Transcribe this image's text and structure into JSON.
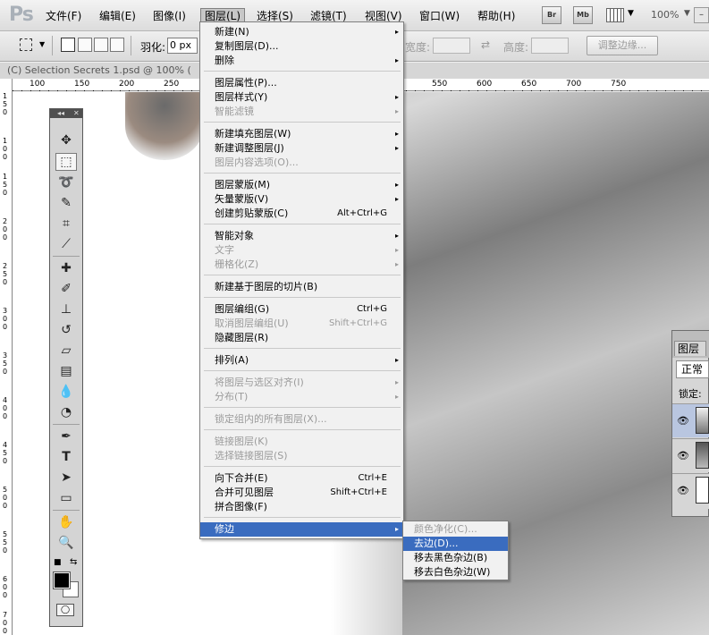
{
  "menubar": {
    "items": [
      "文件(F)",
      "编辑(E)",
      "图像(I)",
      "图层(L)",
      "选择(S)",
      "滤镜(T)",
      "视图(V)",
      "窗口(W)",
      "帮助(H)"
    ],
    "buttons": [
      "Br",
      "Mb"
    ],
    "zoom": "100%"
  },
  "options": {
    "feather_label": "羽化:",
    "feather_value": "0 px",
    "width_label": "宽度:",
    "height_label": "高度:",
    "refine_edge": "调整边缘..."
  },
  "document": {
    "title": "(C) Selection Secrets 1.psd @ 100% ("
  },
  "ruler": {
    "h_ticks": [
      "100",
      "150",
      "200",
      "250",
      "550",
      "600",
      "650",
      "700",
      "750"
    ],
    "v_ticks": [
      "1 5 0",
      "1 0 0",
      "1 5 0",
      "2 0 0",
      "2 5 0",
      "3 0 0",
      "3 5 0",
      "4 0 0",
      "4 5 0",
      "5 0 0",
      "5 5 0",
      "6 0 0",
      "6 5 0",
      "7 0 0"
    ]
  },
  "layer_menu": {
    "items": [
      {
        "label": "新建(N)",
        "shortcut": "",
        "arrow": "▸",
        "disabled": false
      },
      {
        "label": "复制图层(D)...",
        "shortcut": "",
        "arrow": "",
        "disabled": false
      },
      {
        "label": "删除",
        "shortcut": "",
        "arrow": "▸",
        "disabled": false
      },
      {
        "label": "图层属性(P)...",
        "shortcut": "",
        "arrow": "",
        "disabled": false
      },
      {
        "label": "图层样式(Y)",
        "shortcut": "",
        "arrow": "▸",
        "disabled": false
      },
      {
        "label": "智能滤镜",
        "shortcut": "",
        "arrow": "▸",
        "disabled": true
      },
      {
        "label": "新建填充图层(W)",
        "shortcut": "",
        "arrow": "▸",
        "disabled": false
      },
      {
        "label": "新建调整图层(J)",
        "shortcut": "",
        "arrow": "▸",
        "disabled": false
      },
      {
        "label": "图层内容选项(O)...",
        "shortcut": "",
        "arrow": "",
        "disabled": true
      },
      {
        "label": "图层蒙版(M)",
        "shortcut": "",
        "arrow": "▸",
        "disabled": false
      },
      {
        "label": "矢量蒙版(V)",
        "shortcut": "",
        "arrow": "▸",
        "disabled": false
      },
      {
        "label": "创建剪贴蒙版(C)",
        "shortcut": "Alt+Ctrl+G",
        "arrow": "",
        "disabled": false
      },
      {
        "label": "智能对象",
        "shortcut": "",
        "arrow": "▸",
        "disabled": false
      },
      {
        "label": "文字",
        "shortcut": "",
        "arrow": "▸",
        "disabled": true
      },
      {
        "label": "栅格化(Z)",
        "shortcut": "",
        "arrow": "▸",
        "disabled": true
      },
      {
        "label": "新建基于图层的切片(B)",
        "shortcut": "",
        "arrow": "",
        "disabled": false
      },
      {
        "label": "图层编组(G)",
        "shortcut": "Ctrl+G",
        "arrow": "",
        "disabled": false
      },
      {
        "label": "取消图层编组(U)",
        "shortcut": "Shift+Ctrl+G",
        "arrow": "",
        "disabled": true
      },
      {
        "label": "隐藏图层(R)",
        "shortcut": "",
        "arrow": "",
        "disabled": false
      },
      {
        "label": "排列(A)",
        "shortcut": "",
        "arrow": "▸",
        "disabled": false
      },
      {
        "label": "将图层与选区对齐(I)",
        "shortcut": "",
        "arrow": "▸",
        "disabled": true
      },
      {
        "label": "分布(T)",
        "shortcut": "",
        "arrow": "▸",
        "disabled": true
      },
      {
        "label": "锁定组内的所有图层(X)...",
        "shortcut": "",
        "arrow": "",
        "disabled": true
      },
      {
        "label": "链接图层(K)",
        "shortcut": "",
        "arrow": "",
        "disabled": true
      },
      {
        "label": "选择链接图层(S)",
        "shortcut": "",
        "arrow": "",
        "disabled": true
      },
      {
        "label": "向下合并(E)",
        "shortcut": "Ctrl+E",
        "arrow": "",
        "disabled": false
      },
      {
        "label": "合并可见图层",
        "shortcut": "Shift+Ctrl+E",
        "arrow": "",
        "disabled": false
      },
      {
        "label": "拼合图像(F)",
        "shortcut": "",
        "arrow": "",
        "disabled": false
      },
      {
        "label": "修边",
        "shortcut": "",
        "arrow": "▸",
        "disabled": false
      }
    ]
  },
  "matting_submenu": {
    "items": [
      {
        "label": "颜色净化(C)...",
        "disabled": true
      },
      {
        "label": "去边(D)...",
        "disabled": false
      },
      {
        "label": "移去黑色杂边(B)",
        "disabled": false
      },
      {
        "label": "移去白色杂边(W)",
        "disabled": false
      }
    ]
  },
  "layers_panel": {
    "tab": "图层",
    "blend_mode": "正常",
    "lock_label": "锁定:"
  },
  "tools": [
    "move-tool",
    "rect-marquee-tool",
    "lasso-tool",
    "quick-select-tool",
    "crop-tool",
    "eyedropper-tool",
    "healing-brush-tool",
    "brush-tool",
    "clone-stamp-tool",
    "history-brush-tool",
    "eraser-tool",
    "gradient-tool",
    "blur-tool",
    "dodge-tool",
    "pen-tool",
    "type-tool",
    "path-select-tool",
    "shape-tool",
    "hand-tool",
    "zoom-tool"
  ]
}
